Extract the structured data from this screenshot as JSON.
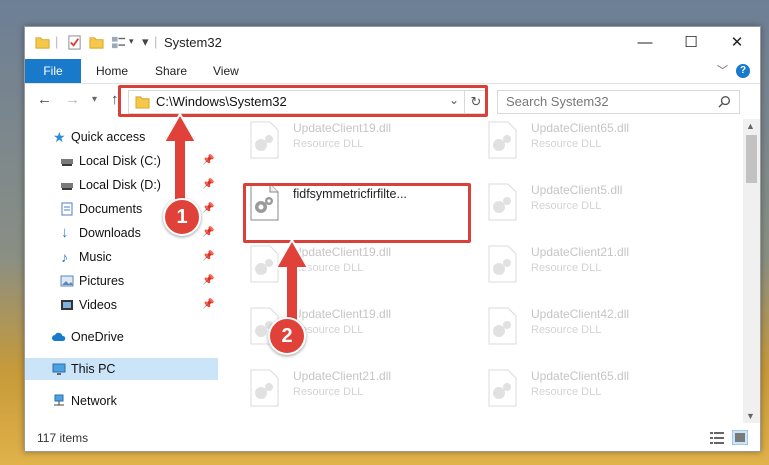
{
  "window": {
    "title": "System32"
  },
  "ribbon": {
    "file": "File",
    "home": "Home",
    "share": "Share",
    "view": "View",
    "help": "?"
  },
  "address": {
    "path": "C:\\Windows\\System32"
  },
  "search": {
    "placeholder": "Search System32"
  },
  "sidebar": {
    "items": [
      {
        "label": "Quick access",
        "icon": "star-icon",
        "pinned": false
      },
      {
        "label": "Local Disk (C:)",
        "icon": "drive-icon",
        "pinned": true
      },
      {
        "label": "Local Disk (D:)",
        "icon": "drive-icon",
        "pinned": true
      },
      {
        "label": "Documents",
        "icon": "documents-icon",
        "pinned": true
      },
      {
        "label": "Downloads",
        "icon": "downloads-icon",
        "pinned": true
      },
      {
        "label": "Music",
        "icon": "music-icon",
        "pinned": true
      },
      {
        "label": "Pictures",
        "icon": "pictures-icon",
        "pinned": true
      },
      {
        "label": "Videos",
        "icon": "videos-icon",
        "pinned": true
      },
      {
        "label": "OneDrive",
        "icon": "cloud-icon",
        "pinned": false
      },
      {
        "label": "This PC",
        "icon": "computer-icon",
        "pinned": false,
        "selected": true
      },
      {
        "label": "Network",
        "icon": "network-icon",
        "pinned": false
      }
    ]
  },
  "files": {
    "col1": [
      {
        "name": "UpdateClient19.dll",
        "desc": "Resource DLL"
      },
      {
        "name": "fidfsymmetricfirfilte...",
        "desc": ""
      },
      {
        "name": "UpdateClient19.dll",
        "desc": "Resource DLL"
      },
      {
        "name": "UpdateClient19.dll",
        "desc": "Resource DLL"
      },
      {
        "name": "UpdateClient21.dll",
        "desc": "Resource DLL"
      }
    ],
    "col2": [
      {
        "name": "UpdateClient65.dll",
        "desc": "Resource DLL"
      },
      {
        "name": "UpdateClient5.dll",
        "desc": "Resource DLL"
      },
      {
        "name": "UpdateClient21.dll",
        "desc": "Resource DLL"
      },
      {
        "name": "UpdateClient42.dll",
        "desc": "Resource DLL"
      },
      {
        "name": "UpdateClient65.dll",
        "desc": "Resource DLL"
      }
    ]
  },
  "status": {
    "count": "117 items"
  },
  "callouts": {
    "step1": "1",
    "step2": "2"
  },
  "colors": {
    "accent": "#1979ca",
    "highlight": "#d9403a",
    "selected": "#cce4f7"
  }
}
